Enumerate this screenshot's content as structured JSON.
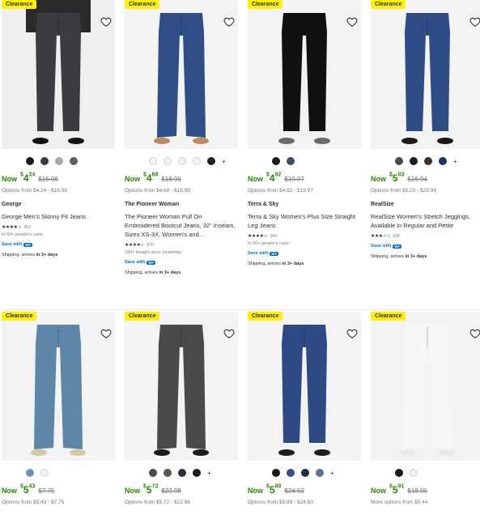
{
  "colors": {
    "accent_green": "#2a8703",
    "clearance_yellow": "#fff200",
    "link_blue": "#0071dc"
  },
  "products": [
    {
      "badge": "Clearance",
      "now": "Now",
      "dollar": "$",
      "whole": "4",
      "cents": "24",
      "was": "$16.98",
      "options": "Options from $4.24 - $16.98",
      "brand": "George",
      "title": "George Men's Skinny Fit Jeans",
      "stars": "★★★★☆",
      "rating_count": "352",
      "meta": "In 50+ people's carts",
      "save": "Save with",
      "wplus": "W+",
      "ship_prefix": "Shipping, arrives ",
      "ship_bold": "in 3+ days",
      "swatches": [
        "#1b1b1b",
        "#3a3a3a",
        "#a9aaa5",
        "#5c5f63"
      ],
      "plus": "",
      "jeans": "#3b3c3f",
      "top": "#2b2b2b",
      "shoe": "#111111"
    },
    {
      "badge": "Clearance",
      "now": "Now",
      "dollar": "$",
      "whole": "4",
      "cents": "68",
      "was": "$18.99",
      "options": "Options from $4.68 - $18.99",
      "brand": "The Pioneer Woman",
      "title": "The Pioneer Woman Pull On Embroidered Bootcut Jeans, 32\" Inseam, Sizes XS-3X, Women's and...",
      "stars": "★★★★☆",
      "rating_count": "670",
      "meta": "100+ bought since yesterday",
      "save": "Save with",
      "wplus": "W+",
      "ship_prefix": "Shipping, arrives ",
      "ship_bold": "in 3+ days",
      "swatches": [
        "#f3f3f3",
        "#f3f3f3",
        "#f3f3f3",
        "#f3f3f3",
        "#222222"
      ],
      "plus": "+",
      "jeans": "#2f4f86",
      "top": "#f4f4f4",
      "shoe": "#c08a5a"
    },
    {
      "badge": "Clearance",
      "now": "Now",
      "dollar": "$",
      "whole": "4",
      "cents": "92",
      "was": "$19.97",
      "options": "Options from $4.92 - $19.97",
      "brand": "Terra & Sky",
      "title": "Terra & Sky Women's Plus Size Straight Leg Jeans",
      "stars": "★★★★☆",
      "rating_count": "344",
      "meta": "In 50+ people's carts",
      "save": "Save with",
      "wplus": "W+",
      "ship_prefix": "Shipping, arrives ",
      "ship_bold": "in 3+ days",
      "swatches": [
        "#1b1b1b",
        "#3e4f63"
      ],
      "plus": "",
      "jeans": "#111111",
      "top": "#f4f4f4",
      "shoe": "#6b6b6b"
    },
    {
      "badge": "Clearance",
      "now": "Now",
      "dollar": "$",
      "whole": "5",
      "cents": "03",
      "was": "$16.94",
      "options": "Options from $5.03 - $29.99",
      "brand": "RealSize",
      "title": "RealSize Women's Stretch Jeggings, Available in Regular and Petite",
      "stars": "★★★☆☆",
      "rating_count": "608",
      "meta": "",
      "save": "Save with",
      "wplus": "W+",
      "ship_prefix": "Shipping, arrives ",
      "ship_bold": "in 3+ days",
      "swatches": [
        "#4a4a4a",
        "#1b1b1b",
        "#3b2f2f",
        "#1e3560"
      ],
      "plus": "+",
      "jeans": "#2e4c86",
      "top": "#f4f4f4",
      "shoe": "#1b1b1b"
    },
    {
      "badge": "Clearance",
      "now": "Now",
      "dollar": "$",
      "whole": "5",
      "cents": "43",
      "was": "$7.75",
      "options": "Options from $5.43 - $7.75",
      "swatches": [
        "#6d93b7",
        "#f3f3f3"
      ],
      "plus": "",
      "jeans": "#5d86a8",
      "top": "#f4f4f4",
      "shoe": "#d8c6a4"
    },
    {
      "badge": "Clearance",
      "now": "Now",
      "dollar": "$",
      "whole": "5",
      "cents": "72",
      "was": "$22.98",
      "options": "Options from $5.72 - $22.98",
      "swatches": [
        "#4a4a4a",
        "#5b5754",
        "#2a2f3a",
        "#1b1b1b"
      ],
      "plus": "+",
      "jeans": "#4a4a4c",
      "top": "#f4f4f4",
      "shoe": "#1b1b1b"
    },
    {
      "badge": "Clearance",
      "now": "Now",
      "dollar": "$",
      "whole": "5",
      "cents": "89",
      "was": "$24.50",
      "options": "Options from $5.89 - $24.50",
      "swatches": [
        "#1b1b1b",
        "#3c4e7a",
        "#1f2a44",
        "#5a6f94"
      ],
      "plus": "+",
      "jeans": "#2d4a86",
      "top": "#f4f4f4",
      "shoe": "#1b1b1b"
    },
    {
      "badge": "Clearance",
      "now": "Now",
      "dollar": "$",
      "whole": "5",
      "cents": "91",
      "was": "$18.00",
      "options": "More options from $5.44",
      "swatches": [
        "#1b1b1b",
        "#f0f0f0"
      ],
      "plus": "",
      "jeans": "#f6f6f6",
      "top": "#f4f4f4",
      "shoe": "#e8e8e8"
    }
  ]
}
